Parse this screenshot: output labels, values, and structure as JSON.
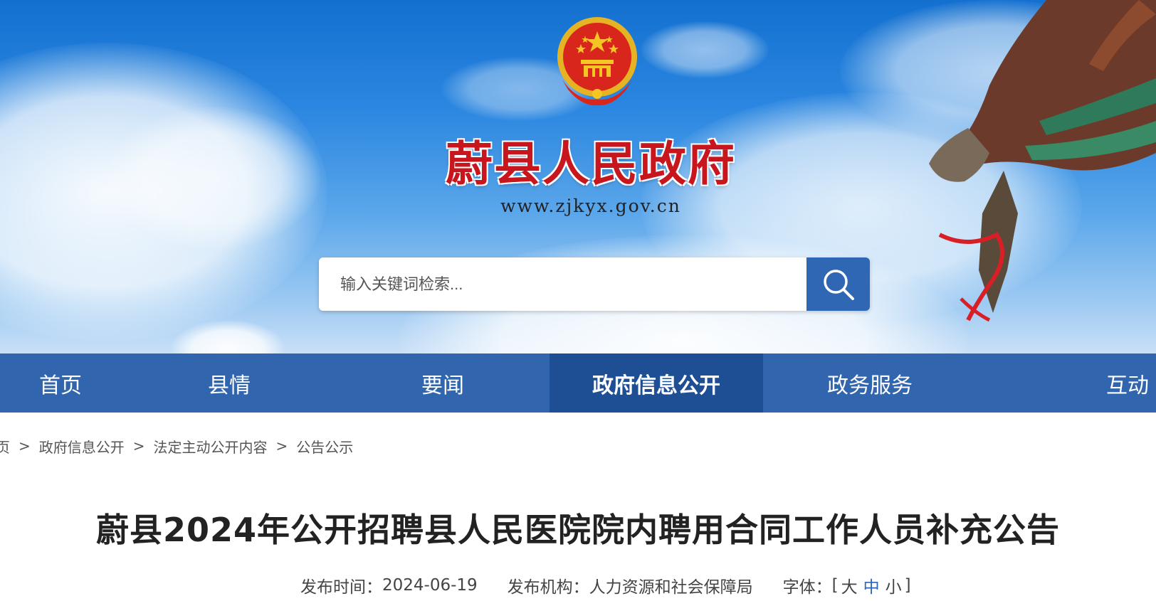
{
  "site": {
    "title": "蔚县人民政府",
    "url": "www.zjkyx.gov.cn"
  },
  "search": {
    "placeholder": "输入关键词检索..."
  },
  "nav": {
    "items": [
      {
        "label": "首页"
      },
      {
        "label": "县情"
      },
      {
        "label": "要闻"
      },
      {
        "label": "政府信息公开",
        "active": true
      },
      {
        "label": "政务服务"
      },
      {
        "label": "互动"
      }
    ]
  },
  "breadcrumb": {
    "items": [
      "页",
      "政府信息公开",
      "法定主动公开内容",
      "公告公示"
    ],
    "separator": ">"
  },
  "article": {
    "title": "蔚县2024年公开招聘县人民医院院内聘用合同工作人员补充公告",
    "meta": {
      "date_label": "发布时间：",
      "date": "2024-06-19",
      "org_label": "发布机构：",
      "org": "人力资源和社会保障局",
      "font_label": "字体：",
      "font_open": "[",
      "font_large": "大",
      "font_medium": "中",
      "font_small": "小",
      "font_close": "]"
    }
  },
  "colors": {
    "nav_bg": "#3165ad",
    "nav_active_bg": "#1e4e94",
    "title_red": "#c7161d",
    "search_button": "#2f67b4"
  }
}
